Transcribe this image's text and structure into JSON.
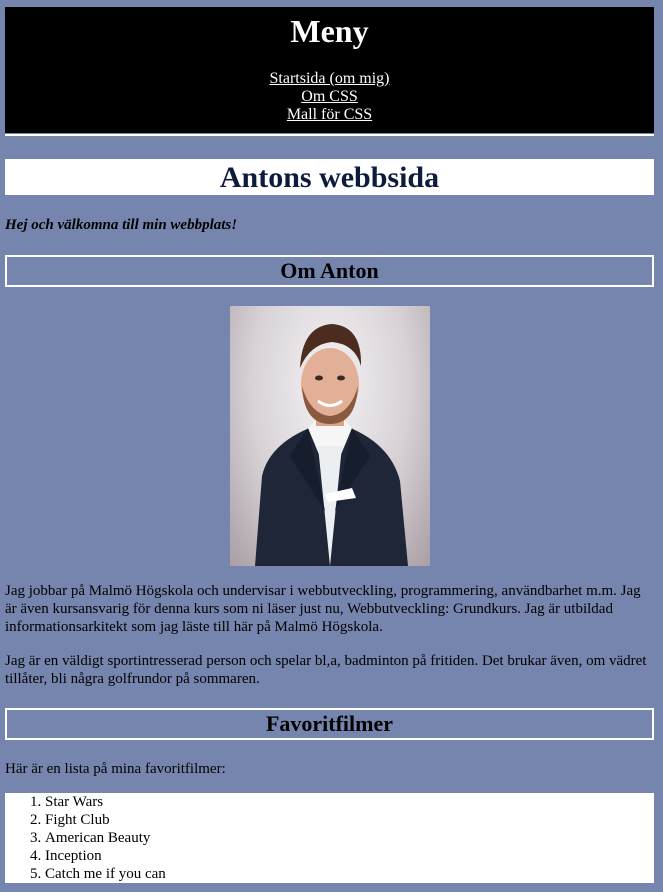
{
  "menu": {
    "title": "Meny",
    "links": [
      "Startsida (om mig)",
      "Om CSS",
      "Mall för CSS"
    ]
  },
  "site_title": "Antons webbsida",
  "welcome": "Hej och välkomna till min webbplats!",
  "about": {
    "heading": "Om Anton",
    "paragraph1": "Jag jobbar på Malmö Högskola och undervisar i webbutveckling, programmering, användbarhet m.m. Jag är även kursansvarig för denna kurs som ni läser just nu, Webbutveckling: Grundkurs. Jag är utbildad informationsarkitekt som jag läste till här på Malmö Högskola.",
    "paragraph2": "Jag är en väldigt sportintresserad person och spelar bl,a, badminton på fritiden. Det brukar även, om vädret tillåter, bli några golfrundor på sommaren."
  },
  "movies": {
    "heading": "Favoritfilmer",
    "intro": "Här är en lista på mina favoritfilmer:",
    "items": [
      "Star Wars",
      "Fight Club",
      "American Beauty",
      "Inception",
      "Catch me if you can"
    ]
  }
}
